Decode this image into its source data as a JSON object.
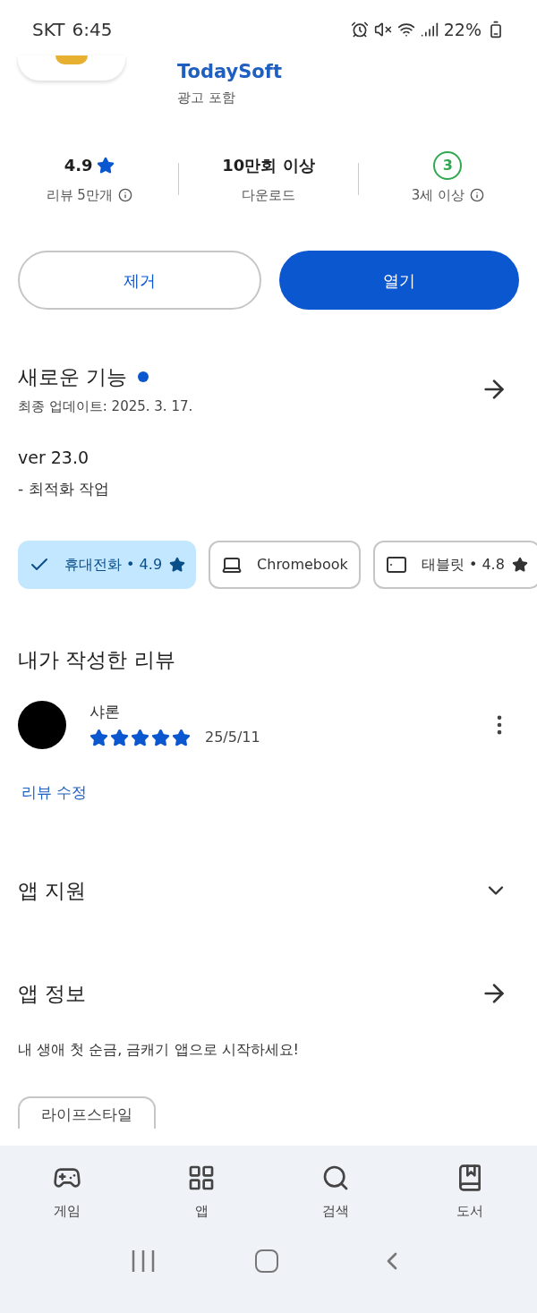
{
  "status_bar": {
    "carrier": "SKT",
    "time": "6:45",
    "battery": "22%"
  },
  "app": {
    "developer": "TodaySoft",
    "ads_note": "광고 포함"
  },
  "stats": [
    {
      "kind": "rating",
      "value": "4.9",
      "label": "리뷰 5만개"
    },
    {
      "kind": "plain",
      "value": "10만회 이상",
      "label": "다운로드"
    },
    {
      "kind": "age",
      "value": "3",
      "label": "3세 이상"
    }
  ],
  "actions": [
    {
      "label": "제거",
      "kind": "outline"
    },
    {
      "label": "열기",
      "kind": "filled"
    }
  ],
  "whats_new": {
    "title": "새로운 기능",
    "date": "최종 업데이트: 2025. 3. 17.",
    "version": "ver 23.0",
    "notes": "- 최적화 작업"
  },
  "devices": [
    {
      "kind": "phone",
      "label": "휴대전화 • 4.9",
      "selected": true
    },
    {
      "kind": "laptop",
      "label": "Chromebook",
      "selected": false
    },
    {
      "kind": "tablet",
      "label": "태블릿 • 4.8",
      "selected": false
    }
  ],
  "my_review": {
    "title": "내가 작성한 리뷰",
    "author": "샤론",
    "stars": 5,
    "date": "25/5/11",
    "edit_link": "리뷰 수정"
  },
  "app_support": {
    "title": "앱 지원",
    "expanded": false
  },
  "app_info": {
    "title": "앱 정보",
    "description": "내 생애 첫 순금, 금캐기 앱으로 시작하세요!",
    "tags": [
      "라이프스타일"
    ]
  },
  "bottom_nav": [
    {
      "kind": "games",
      "label": "게임"
    },
    {
      "kind": "apps",
      "label": "앱"
    },
    {
      "kind": "search",
      "label": "검색"
    },
    {
      "kind": "books",
      "label": "도서"
    }
  ]
}
